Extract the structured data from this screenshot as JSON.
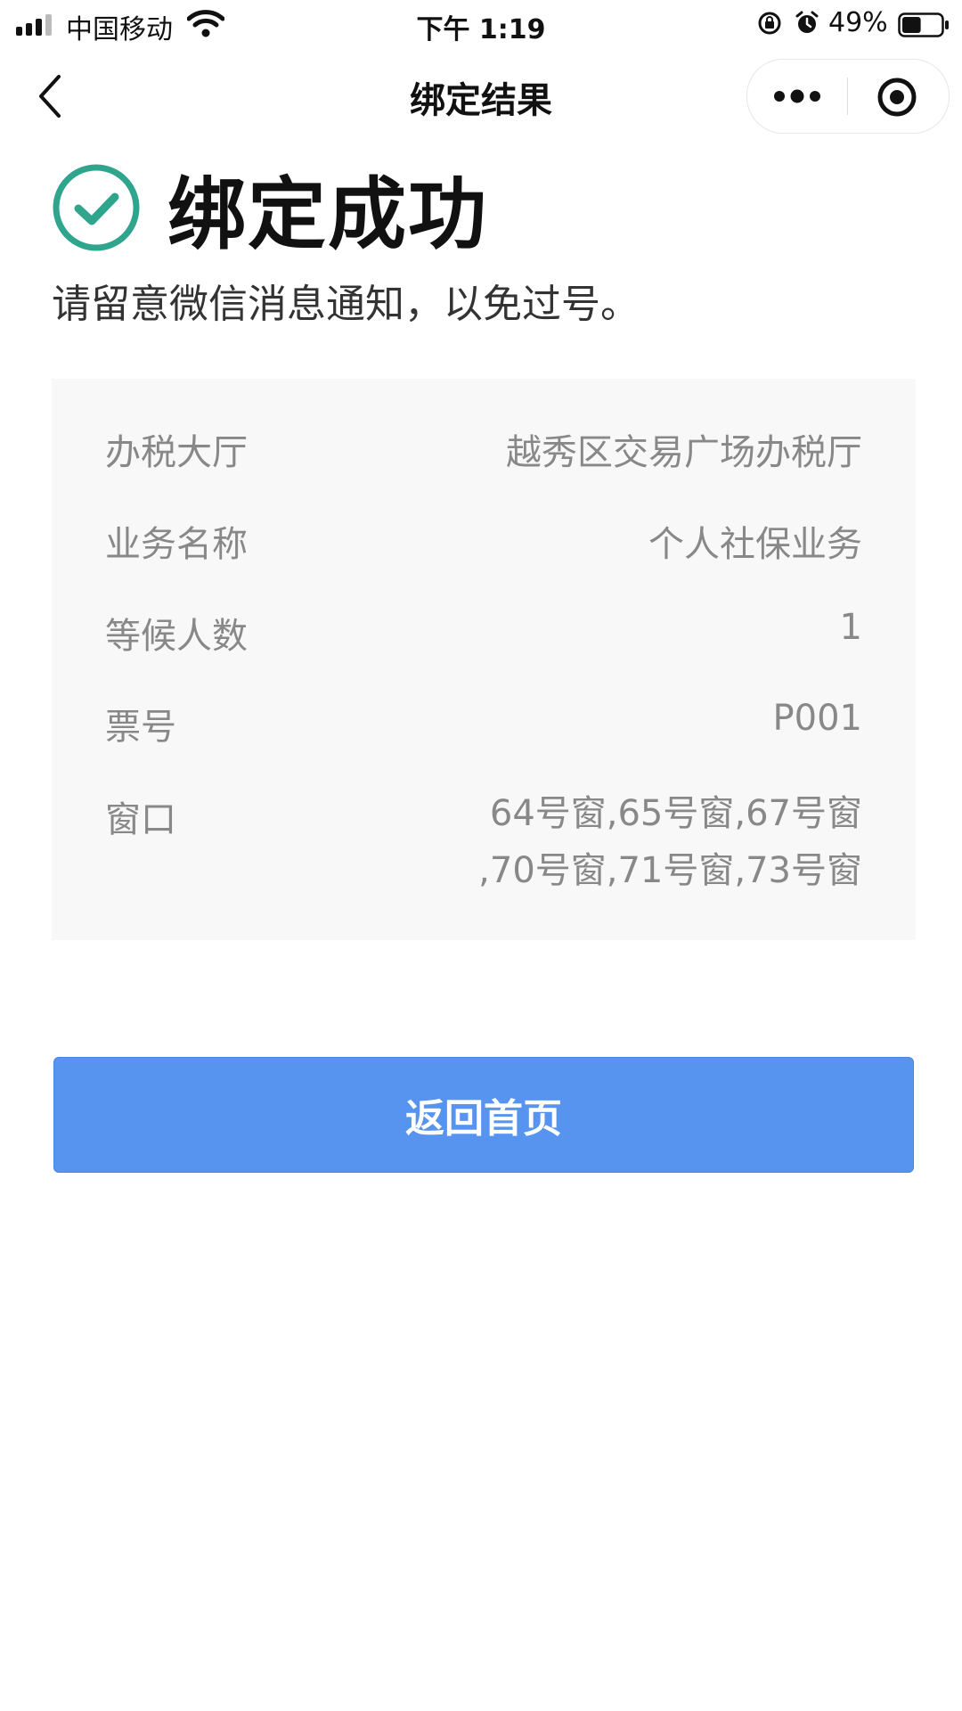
{
  "status_bar": {
    "carrier": "中国移动",
    "time": "下午 1:19",
    "battery_percent": "49%",
    "battery_level": 0.49
  },
  "nav": {
    "title": "绑定结果",
    "icons": [
      "back-arrow-icon",
      "more-dots-icon",
      "target-icon"
    ]
  },
  "result": {
    "title": "绑定成功",
    "notice": "请留意微信消息通知，以免过号。",
    "icon": "check-circle-icon",
    "icon_color": "#2fa58e"
  },
  "details": [
    {
      "label": "办税大厅",
      "value": "越秀区交易广场办税厅"
    },
    {
      "label": "业务名称",
      "value": "个人社保业务"
    },
    {
      "label": "等候人数",
      "value": "1"
    },
    {
      "label": "票号",
      "value": "P001"
    },
    {
      "label": "窗口",
      "value_lines": [
        "64号窗,65号窗,67号窗",
        ",70号窗,71号窗,73号窗"
      ]
    }
  ],
  "button": {
    "label": "返回首页",
    "color": "#5694f0"
  }
}
